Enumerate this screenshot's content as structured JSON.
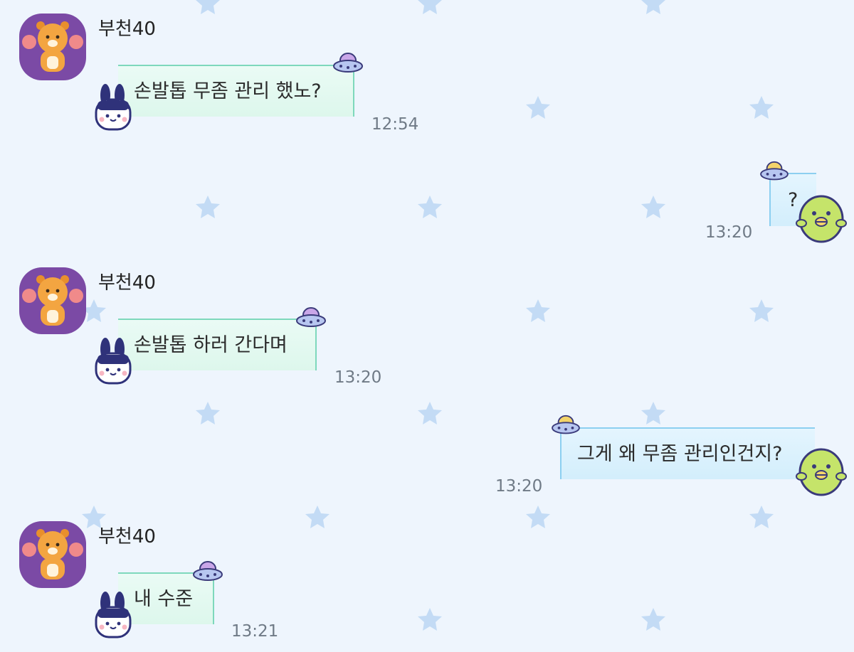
{
  "chat": {
    "messages": [
      {
        "direction": "in",
        "sender": "부천40",
        "text": "손발톱 무좀 관리 했노?",
        "time": "12:54"
      },
      {
        "direction": "out",
        "sender": "",
        "text": "?",
        "time": "13:20"
      },
      {
        "direction": "in",
        "sender": "부천40",
        "text": "손발톱 하러 간다며",
        "time": "13:20"
      },
      {
        "direction": "out",
        "sender": "",
        "text": "그게 왜 무좀 관리인건지?",
        "time": "13:20"
      },
      {
        "direction": "in",
        "sender": "부천40",
        "text": "내 수준",
        "time": "13:21"
      }
    ]
  },
  "theme": {
    "background": "#EEF5FD",
    "star_color": "#BFD8F5",
    "incoming_bubble": "#DDF7EC",
    "outgoing_bubble": "#D3EEFC",
    "avatar_bg": "#7B4AA5"
  },
  "icons": {
    "avatar": "lion-cheerleader-icon",
    "incoming_sticker": "bunny-character-icon",
    "outgoing_sticker": "green-chick-icon",
    "bubble_corner": "ufo-icon",
    "background_pattern": "star-icon"
  }
}
